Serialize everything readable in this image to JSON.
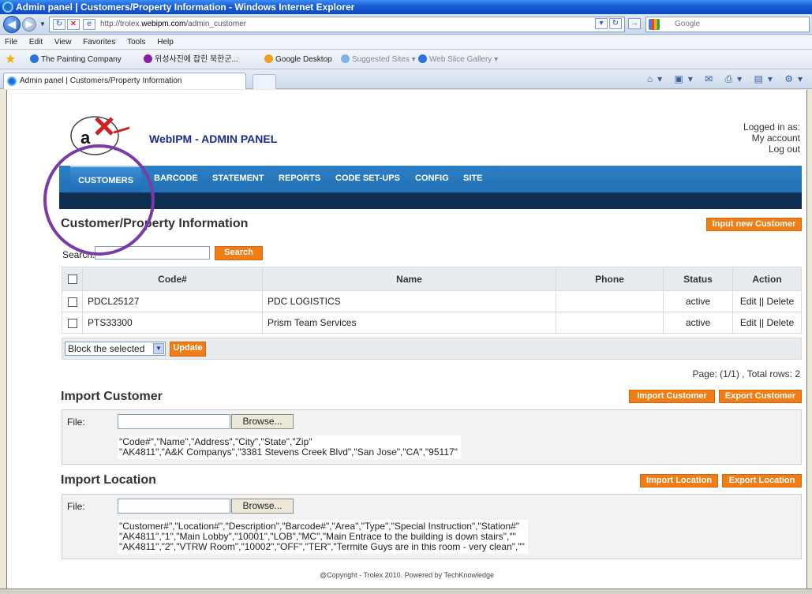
{
  "window": {
    "title": "Admin panel | Customers/Property Information - Windows Internet Explorer"
  },
  "browser": {
    "url_prefix": "http://trolex.",
    "url_domain": "webipm.com",
    "url_path": "/admin_customer",
    "search_placeholder": "Google",
    "menu": [
      "File",
      "Edit",
      "View",
      "Favorites",
      "Tools",
      "Help"
    ],
    "favorites": [
      "The Painting Company",
      "위성사진에 잡힌 북한군...",
      "Google Desktop",
      "Suggested Sites ▾",
      "Web Slice Gallery ▾"
    ],
    "tab_title": "Admin panel | Customers/Property Information"
  },
  "header": {
    "app_title": "WebIPM - ADMIN PANEL",
    "logged_in_label": "Logged in as:",
    "my_account": "My account",
    "log_out": "Log out"
  },
  "nav": [
    "CUSTOMERS",
    "BARCODE",
    "STATEMENT",
    "REPORTS",
    "CODE SET-UPS",
    "CONFIG",
    "SITE"
  ],
  "customers": {
    "title": "Customer/Property Information",
    "new_button": "Input new Customer",
    "search_label": "Search:",
    "search_button": "Search",
    "columns": [
      "Code#",
      "Name",
      "Phone",
      "Status",
      "Action"
    ],
    "rows": [
      {
        "code": "PDCL25127",
        "name": "PDC LOGISTICS",
        "phone": "",
        "status": "active",
        "action": "Edit || Delete"
      },
      {
        "code": "PTS33300",
        "name": "Prism Team Services",
        "phone": "",
        "status": "active",
        "action": "Edit || Delete"
      }
    ],
    "bulk_option": "Block the selected",
    "update_button": "Update",
    "pager": "Page: (1/1) , Total rows: 2"
  },
  "import_customer": {
    "title": "Import Customer",
    "import_button": "Import Customer",
    "export_button": "Export Customer",
    "file_label": "File:",
    "browse": "Browse...",
    "sample": "\"Code#\",\"Name\",\"Address\",\"City\",\"State\",\"Zip\"\n\"AK4811\",\"A&K Companys\",\"3381 Stevens Creek Blvd\",\"San Jose\",\"CA\",\"95117\""
  },
  "import_location": {
    "title": "Import Location",
    "import_button": "Import Location",
    "export_button": "Export Location",
    "file_label": "File:",
    "browse": "Browse...",
    "sample": "\"Customer#\",\"Location#\",\"Description\",\"Barcode#\",\"Area\",\"Type\",\"Special Instruction\",\"Station#\"\n\"AK4811\",\"1\",\"Main Lobby\",\"10001\",\"LOB\",\"MC\",\"Main Entrace to the building is down stairs\",\"\"\n\"AK4811\",\"2\",\"VTRW Room\",\"10002\",\"OFF\",\"TER\",\"Termite Guys are in this room - very clean\",\"\""
  },
  "footer": {
    "copyright": "@Copyright - Trolex 2010. Powered by TechKnowledge"
  },
  "colors": {
    "accent_orange": "#f07d16",
    "nav_blue": "#2c7ec4",
    "annotation_circle": "#7a3aa8"
  }
}
